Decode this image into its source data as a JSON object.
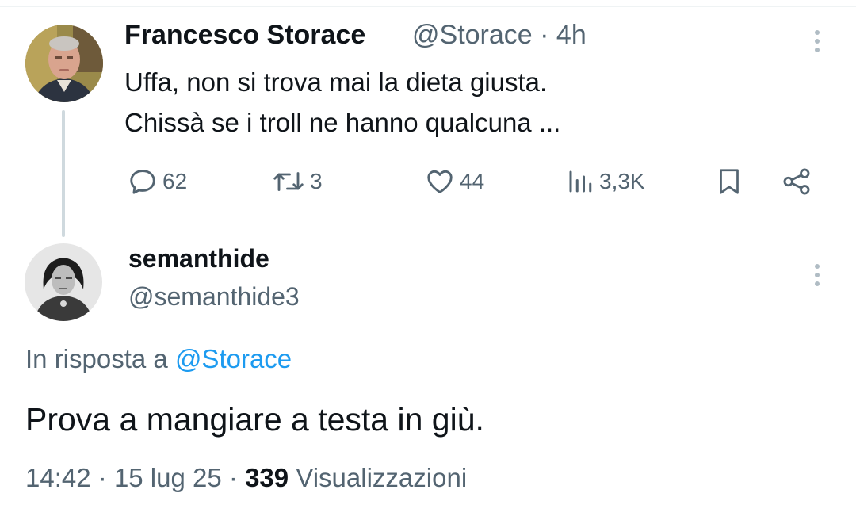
{
  "parent_tweet": {
    "author_name": "Francesco Storace",
    "meta": "@Storace · 4h",
    "text": "Uffa, non si trova mai la dieta giusta.\nChissà se i troll ne hanno qualcuna ...",
    "actions": {
      "replies": "62",
      "retweets": "3",
      "likes": "44",
      "views": "3,3K"
    }
  },
  "reply_tweet": {
    "author_name": "semanthide",
    "handle": "@semanthide3",
    "reply_prefix": "In risposta a",
    "reply_mention": "@Storace",
    "text": "Prova a mangiare a testa in giù.",
    "time": "14:42",
    "date": "15 lug 25",
    "views_count": "339",
    "views_label": "Visualizzazioni"
  },
  "colors": {
    "text_primary": "#0f1419",
    "text_secondary": "#536471",
    "link": "#1d9bf0",
    "thread_line": "#cfd9de"
  },
  "icons": [
    "kebab-icon",
    "reply-icon",
    "retweet-icon",
    "like-icon",
    "views-icon",
    "bookmark-icon",
    "share-icon"
  ]
}
